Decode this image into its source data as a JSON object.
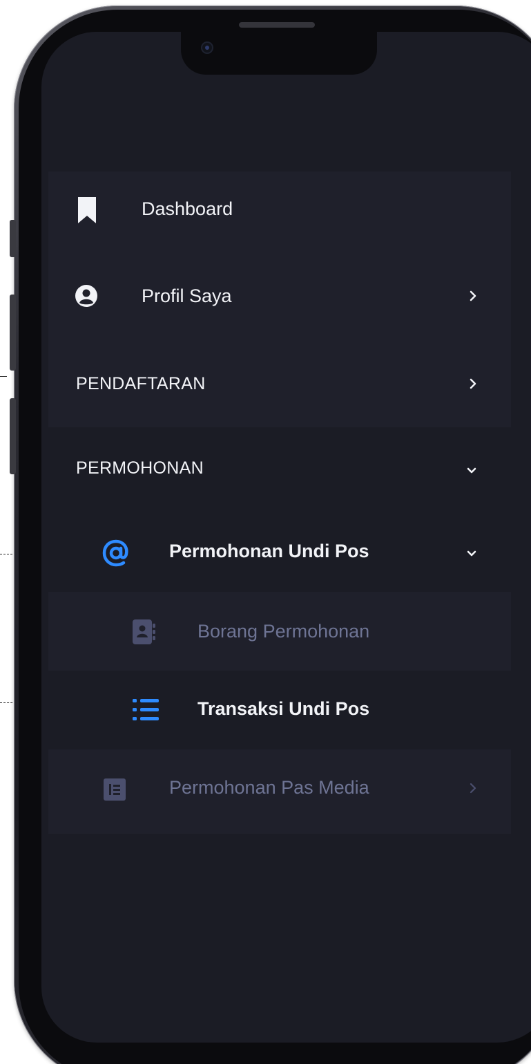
{
  "colors": {
    "screen_bg": "#1b1c25",
    "row_highlight": "#1f202b",
    "text_primary": "#f2f3f7",
    "text_muted": "#6e7494",
    "accent_blue": "#2e8bff",
    "muted_icon": "#4b4f6e"
  },
  "menu": {
    "dashboard": {
      "label": "Dashboard",
      "icon": "bookmark-icon"
    },
    "profil": {
      "label": "Profil Saya",
      "icon": "user-circle-icon",
      "chevron": "chevron-right-icon"
    },
    "pendaftaran": {
      "label": "PENDAFTARAN",
      "chevron": "chevron-right-icon"
    },
    "permohonan": {
      "label": "PERMOHONAN",
      "chevron": "chevron-down-icon"
    },
    "undi_pos": {
      "label": "Permohonan Undi Pos",
      "icon": "at-sign-icon",
      "chevron": "chevron-down-icon"
    },
    "borang": {
      "label": "Borang Permohonan",
      "icon": "contact-book-icon"
    },
    "transaksi": {
      "label": "Transaksi Undi Pos",
      "icon": "list-icon"
    },
    "pas_media": {
      "label": "Permohonan Pas Media",
      "icon": "list-box-icon",
      "chevron": "chevron-right-icon"
    }
  }
}
